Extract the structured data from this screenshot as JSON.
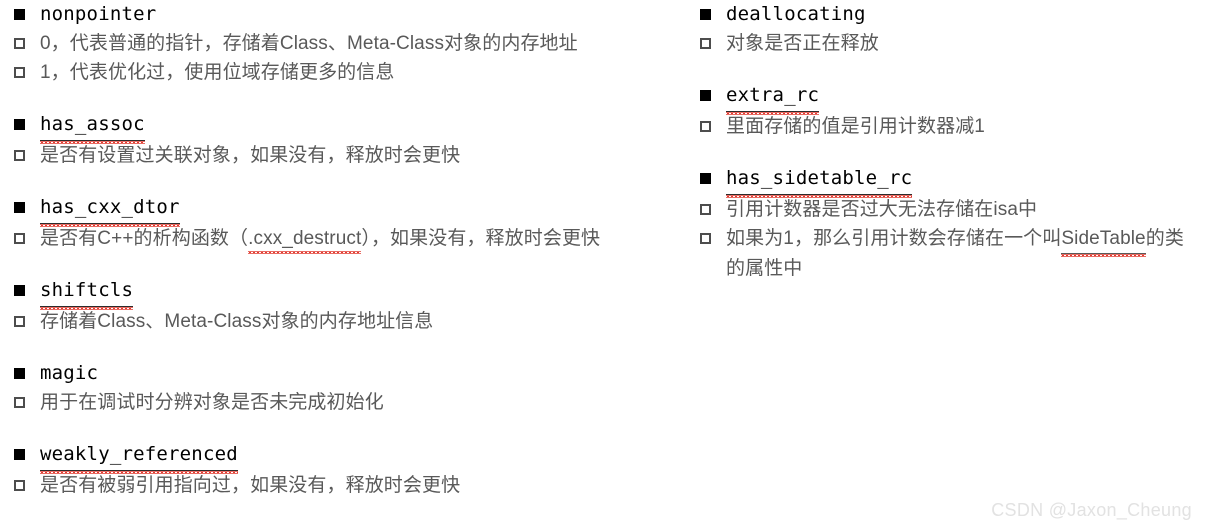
{
  "watermark": "CSDN @Jaxon_Cheung",
  "left_column": {
    "groups": [
      {
        "title": "nonpointer",
        "title_misspelled": false,
        "items": [
          "0，代表普通的指针，存储着Class、Meta-Class对象的内存地址",
          "1，代表优化过，使用位域存储更多的信息"
        ]
      },
      {
        "title": "has_assoc",
        "title_misspelled": true,
        "items": [
          "是否有设置过关联对象，如果没有，释放时会更快"
        ]
      },
      {
        "title": "has_cxx_dtor",
        "title_misspelled": true,
        "items": [
          "是否有C++的析构函数（.cxx_destruct），如果没有，释放时会更快"
        ],
        "item_parts": [
          {
            "pre": "是否有C++的析构函数（",
            "mark": ".cxx_destruct",
            "post": "），如果没有，释放时会更快"
          }
        ]
      },
      {
        "title": "shiftcls",
        "title_misspelled": true,
        "items": [
          "存储着Class、Meta-Class对象的内存地址信息"
        ]
      },
      {
        "title": "magic",
        "title_misspelled": false,
        "items": [
          "用于在调试时分辨对象是否未完成初始化"
        ]
      },
      {
        "title": "weakly_referenced",
        "title_misspelled": true,
        "items": [
          "是否有被弱引用指向过，如果没有，释放时会更快"
        ]
      }
    ]
  },
  "right_column": {
    "groups": [
      {
        "title": "deallocating",
        "title_misspelled": false,
        "items": [
          "对象是否正在释放"
        ]
      },
      {
        "title": "extra_rc",
        "title_misspelled": true,
        "items": [
          "里面存储的值是引用计数器减1"
        ]
      },
      {
        "title": "has_sidetable_rc",
        "title_misspelled": true,
        "items": [
          "引用计数器是否过大无法存储在isa中",
          "如果为1，那么引用计数会存储在一个叫SideTable的类的属性中"
        ],
        "item_parts": [
          null,
          {
            "pre": "如果为1，那么引用计数会存储在一个叫",
            "mark": "SideTable",
            "post": "的类的属性中"
          }
        ]
      }
    ]
  }
}
